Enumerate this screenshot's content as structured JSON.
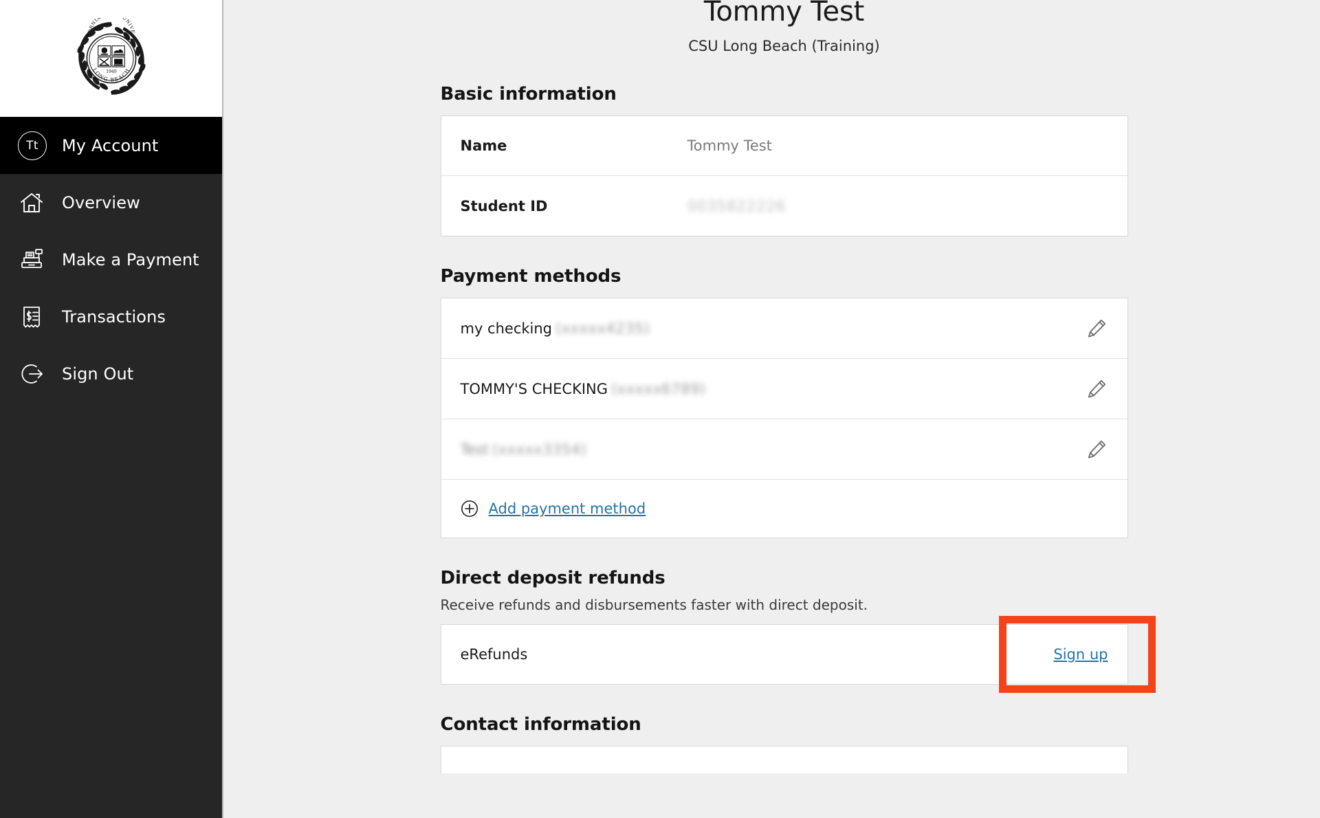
{
  "sidebar": {
    "logo": {
      "icon": "csulb-seal-icon",
      "alt": "California State University Long Beach seal",
      "line1": "CALIFORNIA STATE UNIVERSITY",
      "line2": "LONG BEACH",
      "year": "1949"
    },
    "items": [
      {
        "label": "My Account",
        "icon": "user-avatar-icon",
        "initials": "Tt",
        "active": true
      },
      {
        "label": "Overview",
        "icon": "home-icon",
        "active": false
      },
      {
        "label": "Make a Payment",
        "icon": "cash-register-icon",
        "active": false
      },
      {
        "label": "Transactions",
        "icon": "receipt-dollar-icon",
        "active": false
      },
      {
        "label": "Sign Out",
        "icon": "sign-out-icon",
        "active": false
      }
    ]
  },
  "header": {
    "title": "Tommy Test",
    "subtitle": "CSU Long Beach (Training)"
  },
  "basic_information": {
    "heading": "Basic information",
    "rows": [
      {
        "label": "Name",
        "value": "Tommy Test",
        "redacted": false
      },
      {
        "label": "Student ID",
        "value": "0035822226",
        "redacted": true
      }
    ]
  },
  "payment_methods": {
    "heading": "Payment methods",
    "items": [
      {
        "name": "my checking",
        "account": "(xxxxx4235)",
        "edit_icon": "pencil-edit-icon"
      },
      {
        "name": "TOMMY'S CHECKING",
        "account": "(xxxxx6789)",
        "edit_icon": "pencil-edit-icon"
      },
      {
        "name": "Test",
        "account": "(xxxxx3354)",
        "edit_icon": "pencil-edit-icon"
      }
    ],
    "add_label": "Add payment method",
    "add_icon": "plus-circle-icon"
  },
  "direct_deposit": {
    "heading": "Direct deposit refunds",
    "description": "Receive refunds and disbursements faster with direct deposit.",
    "row_label": "eRefunds",
    "action_label": "Sign up"
  },
  "contact_information": {
    "heading": "Contact information"
  },
  "colors": {
    "sidebar_bg": "#262626",
    "sidebar_active_bg": "#000000",
    "page_bg": "#efefef",
    "card_bg": "#ffffff",
    "link": "#2274a5",
    "highlight": "#f4421a",
    "text": "#1a1a1a",
    "muted_text": "#7a7a7a"
  }
}
